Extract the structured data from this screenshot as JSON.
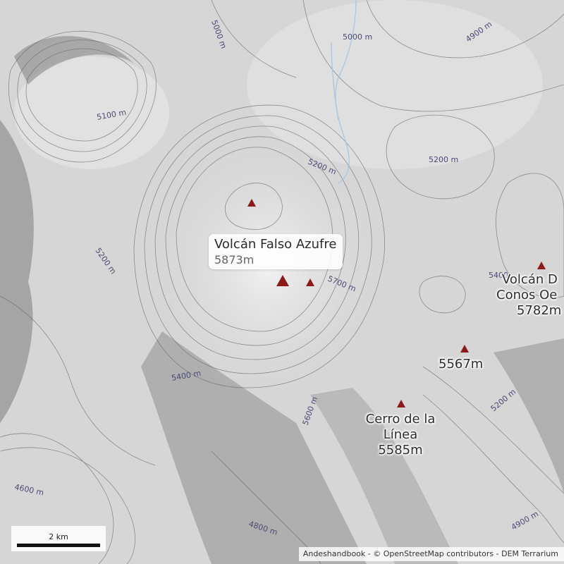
{
  "contour_labels": [
    "5000 m",
    "5000 m",
    "4900 m",
    "5100 m",
    "5200 m",
    "5200 m",
    "5200 m",
    "5700 m",
    "5400 m",
    "5600 m",
    "5200 m",
    "4600 m",
    "4800 m",
    "4900 m",
    "5400"
  ],
  "popup": {
    "name": "Volcán Falso Azufre",
    "elevation": "5873m"
  },
  "peaks": [
    {
      "name_lines": [
        "Volcán D",
        "Conos Oe"
      ],
      "elevation": "5782m"
    },
    {
      "name_lines": [],
      "elevation": "5567m"
    },
    {
      "name_lines": [
        "Cerro de la",
        "Línea"
      ],
      "elevation": "5585m"
    }
  ],
  "scale_bar": {
    "label": "2 km"
  },
  "attribution": "Andeshandbook - © OpenStreetMap contributors - DEM Terrarium",
  "colors": {
    "peak_marker": "#8b1a1a",
    "contour": "#6a6a6a",
    "contour_label": "#4a4a78",
    "stream": "#a8c4e0"
  }
}
